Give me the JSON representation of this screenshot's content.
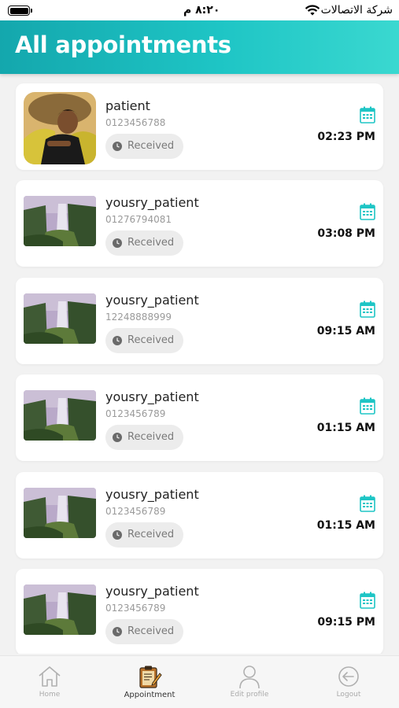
{
  "status_bar": {
    "time": "٨:٢٠ م",
    "carrier": "شركة الاتصالات"
  },
  "header": {
    "title": "All appointments"
  },
  "appointments": [
    {
      "name": "patient",
      "phone": "0123456788",
      "status": "Received",
      "time": "02:23 PM",
      "avatar": "person-photo"
    },
    {
      "name": "yousry_patient",
      "phone": "01276794081",
      "status": "Received",
      "time": "03:08 PM",
      "avatar": "waterfall-photo"
    },
    {
      "name": "yousry_patient",
      "phone": "12248888999",
      "status": "Received",
      "time": "09:15 AM",
      "avatar": "waterfall-photo"
    },
    {
      "name": "yousry_patient",
      "phone": "0123456789",
      "status": "Received",
      "time": "01:15 AM",
      "avatar": "waterfall-photo"
    },
    {
      "name": "yousry_patient",
      "phone": "0123456789",
      "status": "Received",
      "time": "01:15 AM",
      "avatar": "waterfall-photo"
    },
    {
      "name": "yousry_patient",
      "phone": "0123456789",
      "status": "Received",
      "time": "09:15 PM",
      "avatar": "waterfall-photo"
    }
  ],
  "nav": {
    "home": "Home",
    "appointment": "Appointment",
    "edit_profile": "Edit profile",
    "logout": "Logout"
  },
  "colors": {
    "accent": "#1ec5c5",
    "badge_bg": "#ececec"
  }
}
